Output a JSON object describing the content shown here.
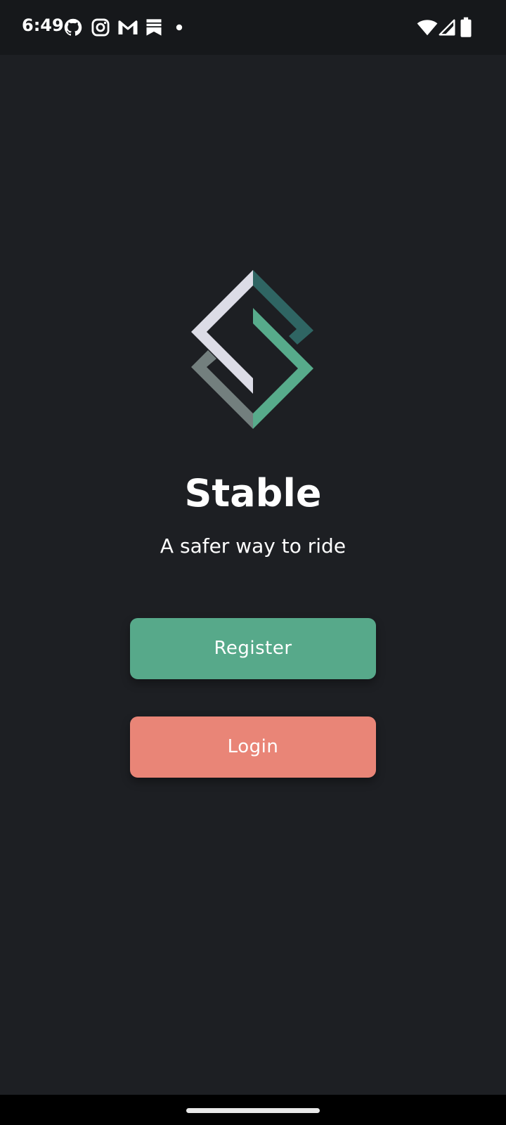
{
  "status_bar": {
    "time": "6:49",
    "notification_icons": [
      "github-icon",
      "instagram-icon",
      "gmail-icon",
      "bookmark-icon",
      "more-notifications-dot-icon"
    ],
    "system_icons": [
      "wifi-icon",
      "cellular-signal-icon",
      "battery-icon"
    ]
  },
  "app": {
    "name": "Stable",
    "tagline": "A safer way to ride",
    "logo": "stable-logo"
  },
  "actions": {
    "register_label": "Register",
    "login_label": "Login"
  },
  "colors": {
    "background": "#1d1f23",
    "status_bar": "#16181b",
    "register_button": "#57a98a",
    "login_button": "#e98577",
    "logo_light": "#dcdce6",
    "logo_dark_teal": "#2f6563",
    "logo_green": "#57ab8b",
    "logo_grey": "#737f7e",
    "text": "#ffffff"
  }
}
